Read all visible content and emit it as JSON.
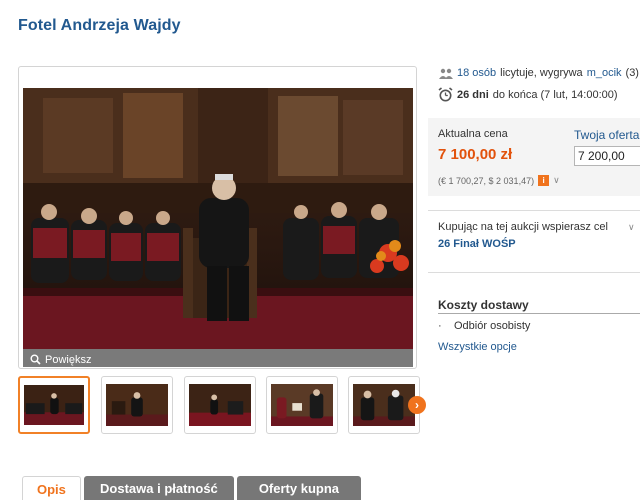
{
  "title": "Fotel Andrzeja Wajdy",
  "gallery": {
    "zoom_label": "Powiększ",
    "thumbnail_count": 5,
    "next_arrow": "›"
  },
  "auction": {
    "bidders_count": "18 osób",
    "bidders_text": "licytuje, wygrywa",
    "leader": "m_ocik",
    "leader_score": "(3)",
    "days_left": "26 dni",
    "ending_text": "do końca (7 lut, 14:00:00)"
  },
  "price": {
    "current_label": "Aktualna cena",
    "current_value": "7 100,00 zł",
    "converted": "(€ 1 700,27, $ 2 031,47)",
    "offer_label": "Twoja oferta",
    "offer_value": "7 200,00"
  },
  "charity": {
    "text": "Kupując na tej aukcji wspierasz cel",
    "link": "26 Finał WOŚP"
  },
  "shipping": {
    "title": "Koszty dostawy",
    "option": "Odbiór osobisty",
    "all_options": "Wszystkie opcje"
  },
  "tabs": [
    {
      "label": "Opis",
      "active": true
    },
    {
      "label": "Dostawa i płatność",
      "active": false
    },
    {
      "label": "Oferty kupna",
      "active": false
    }
  ],
  "colors": {
    "link": "#22598f",
    "accent": "#f0731d",
    "price": "#e2520c"
  },
  "icons": {
    "zoom": "magnifier-icon",
    "bidders": "people-icon",
    "ending": "alarm-clock-icon",
    "info": "info-badge-icon"
  }
}
